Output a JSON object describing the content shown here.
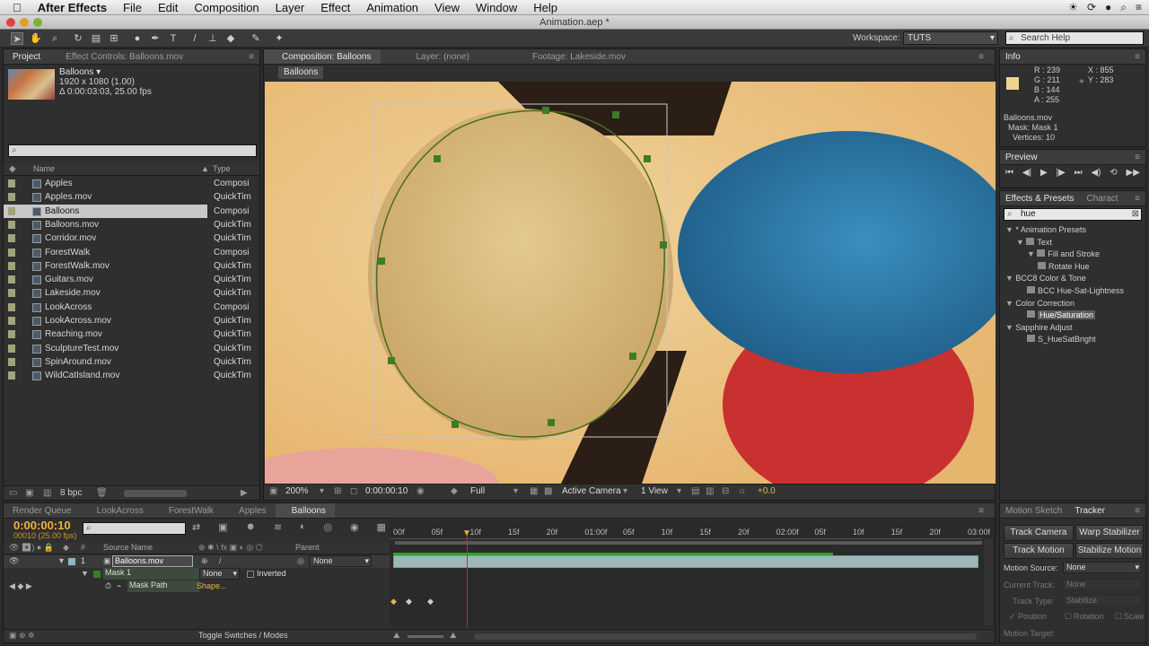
{
  "menubar": {
    "app": "After Effects",
    "items": [
      "File",
      "Edit",
      "Composition",
      "Layer",
      "Effect",
      "Animation",
      "View",
      "Window",
      "Help"
    ]
  },
  "window": {
    "title": "Animation.aep *"
  },
  "toolbar": {
    "workspace_label": "Workspace:",
    "workspace_value": "TUTS",
    "search_placeholder": "Search Help"
  },
  "project": {
    "tabs": [
      "Project",
      "Effect Controls: Balloons.mov"
    ],
    "selected_name": "Balloons ▾",
    "selected_res": "1920 x 1080 (1.00)",
    "selected_dur": "Δ 0:00:03:03, 25.00 fps",
    "col_name": "Name",
    "col_type": "Type",
    "items": [
      {
        "name": "Apples",
        "type": "Composi"
      },
      {
        "name": "Apples.mov",
        "type": "QuickTim"
      },
      {
        "name": "Balloons",
        "type": "Composi"
      },
      {
        "name": "Balloons.mov",
        "type": "QuickTim"
      },
      {
        "name": "Corridor.mov",
        "type": "QuickTim"
      },
      {
        "name": "ForestWalk",
        "type": "Composi"
      },
      {
        "name": "ForestWalk.mov",
        "type": "QuickTim"
      },
      {
        "name": "Guitars.mov",
        "type": "QuickTim"
      },
      {
        "name": "Lakeside.mov",
        "type": "QuickTim"
      },
      {
        "name": "LookAcross",
        "type": "Composi"
      },
      {
        "name": "LookAcross.mov",
        "type": "QuickTim"
      },
      {
        "name": "Reaching.mov",
        "type": "QuickTim"
      },
      {
        "name": "SculptureTest.mov",
        "type": "QuickTim"
      },
      {
        "name": "SpinAround.mov",
        "type": "QuickTim"
      },
      {
        "name": "WildCatIsland.mov",
        "type": "QuickTim"
      }
    ],
    "bpc": "8 bpc"
  },
  "comp": {
    "tabs": [
      "Composition: Balloons",
      "Layer: (none)",
      "Footage: Lakeside.mov"
    ],
    "breadcrumb": "Balloons",
    "zoom": "200%",
    "time": "0:00:00:10",
    "resolution": "Full",
    "camera": "Active Camera",
    "views": "1 View",
    "exposure": "+0.0"
  },
  "info": {
    "tab": "Info",
    "r": "R : 239",
    "g": "G : 211",
    "b": "B : 144",
    "a": "A : 255",
    "x": "X : 855",
    "y": "Y : 283",
    "line1": "Balloons.mov",
    "line2": "Mask: Mask 1",
    "line3": "Vertices: 10",
    "swatch": "#eed390"
  },
  "preview": {
    "tab": "Preview"
  },
  "effects": {
    "tabs": [
      "Effects & Presets",
      "Charact"
    ],
    "search": "hue",
    "tree": [
      {
        "label": "* Animation Presets",
        "indent": 0
      },
      {
        "label": "Text",
        "indent": 1
      },
      {
        "label": "Fill and Stroke",
        "indent": 2
      },
      {
        "label": "Rotate Hue",
        "indent": 3
      },
      {
        "label": "BCC8 Color & Tone",
        "indent": 0
      },
      {
        "label": "BCC Hue-Sat-Lightness",
        "indent": 2
      },
      {
        "label": "Color Correction",
        "indent": 0
      },
      {
        "label": "Hue/Saturation",
        "indent": 2
      },
      {
        "label": "Sapphire Adjust",
        "indent": 0
      },
      {
        "label": "S_HueSatBright",
        "indent": 2
      }
    ]
  },
  "timeline": {
    "tabs": [
      "Render Queue",
      "LookAcross",
      "ForestWalk",
      "Apples",
      "Balloons"
    ],
    "timecode": "0:00:00:10",
    "frames": "00010 (25.00 fps)",
    "col_source": "Source Name",
    "col_parent": "Parent",
    "layer_num": "1",
    "layer_name": "Balloons.mov",
    "parent": "None",
    "mask_name": "Mask 1",
    "mask_mode": "None",
    "inverted": "Inverted",
    "mask_path": "Mask Path",
    "shape": "Shape...",
    "toggle": "Toggle Switches / Modes",
    "ruler": [
      "00f",
      "05f",
      "10f",
      "15f",
      "20f",
      "01:00f",
      "05f",
      "10f",
      "15f",
      "20f",
      "02:00f",
      "05f",
      "10f",
      "15f",
      "20f",
      "03:00f"
    ]
  },
  "tracker": {
    "tabs": [
      "Motion Sketch",
      "Tracker"
    ],
    "btn_track_camera": "Track Camera",
    "btn_warp": "Warp Stabilizer",
    "btn_track_motion": "Track Motion",
    "btn_stabilize": "Stabilize Motion",
    "motion_source_label": "Motion Source:",
    "motion_source": "None",
    "current_track_label": "Current Track:",
    "current_track": "None",
    "track_type_label": "Track Type:",
    "track_type": "Stabilize",
    "position": "Position",
    "rotation": "Rotation",
    "scale": "Scale",
    "motion_target": "Motion Target:"
  }
}
